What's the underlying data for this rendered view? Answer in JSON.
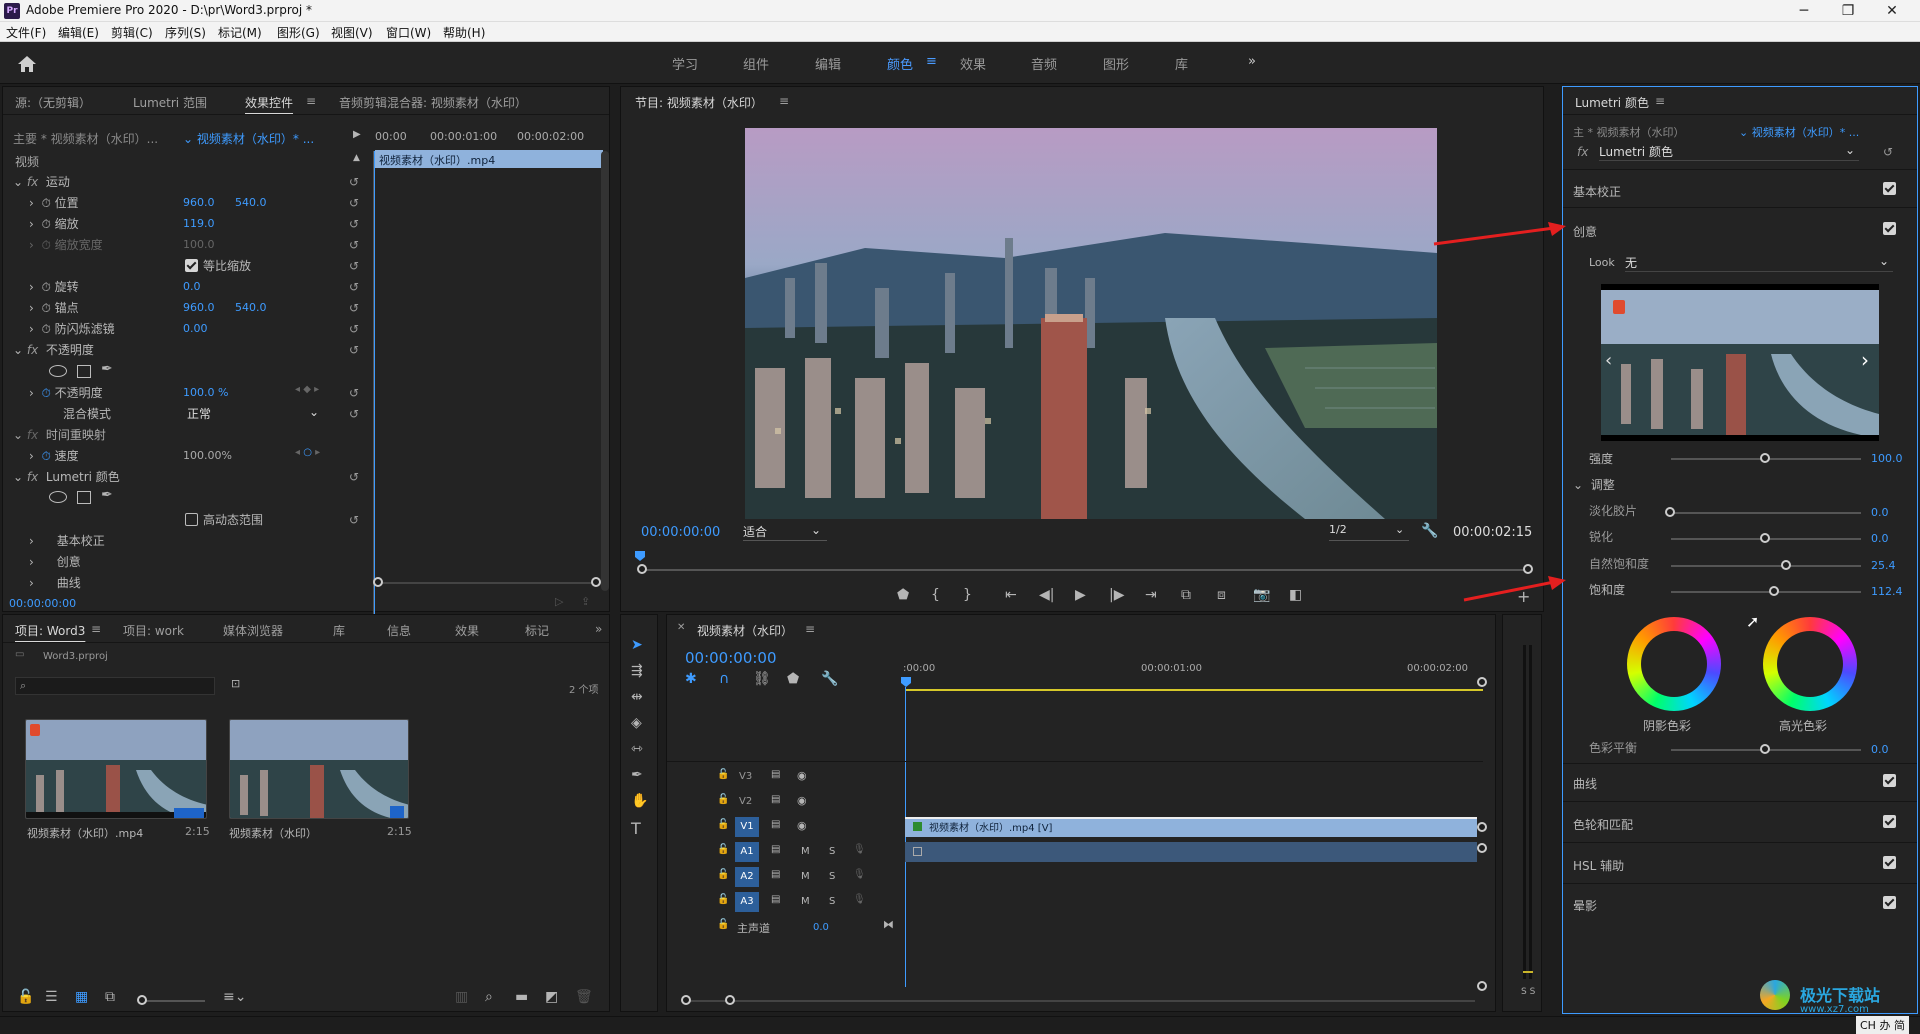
{
  "app": {
    "title": "Adobe Premiere Pro 2020 - D:\\pr\\Word3.prproj *",
    "icon": "Pr"
  },
  "menu": [
    "文件(F)",
    "编辑(E)",
    "剪辑(C)",
    "序列(S)",
    "标记(M)",
    "图形(G)",
    "视图(V)",
    "窗口(W)",
    "帮助(H)"
  ],
  "workspaces": {
    "tabs": [
      "学习",
      "组件",
      "编辑",
      "颜色",
      "效果",
      "音频",
      "图形",
      "库"
    ],
    "active": "颜色",
    "more": "»"
  },
  "effect_controls": {
    "tabs": [
      "源:（无剪辑）",
      "Lumetri 范围",
      "效果控件",
      "音频剪辑混合器: 视频素材（水印）"
    ],
    "active_tab": "效果控件",
    "master": "主要 * 视频素材（水印）...",
    "clip": "视频素材（水印）* ...",
    "ruler": [
      "00:00",
      "00:00:01:00",
      "00:00:02:00"
    ],
    "clip_bar": "视频素材（水印）.mp4",
    "section_video": "视频",
    "motion": "运动",
    "position": {
      "label": "位置",
      "x": "960.0",
      "y": "540.0"
    },
    "scale": {
      "label": "缩放",
      "value": "119.0"
    },
    "scale_width": {
      "label": "缩放宽度",
      "value": "100.0"
    },
    "uniform": "等比缩放",
    "rotation": {
      "label": "旋转",
      "value": "0.0"
    },
    "anchor": {
      "label": "锚点",
      "x": "960.0",
      "y": "540.0"
    },
    "flicker": {
      "label": "防闪烁滤镜",
      "value": "0.00"
    },
    "opacity_group": "不透明度",
    "opacity": {
      "label": "不透明度",
      "value": "100.0 %"
    },
    "blend": {
      "label": "混合模式",
      "value": "正常"
    },
    "time_remap": "时间重映射",
    "speed": {
      "label": "速度",
      "value": "100.00%"
    },
    "lumetri": "Lumetri 颜色",
    "hdr": "高动态范围",
    "basic": "基本校正",
    "creative": "创意",
    "curves": "曲线",
    "timecode": "00:00:00:00"
  },
  "program": {
    "title": "节目: 视频素材（水印）",
    "timecode": "00:00:00:00",
    "fit": "适合",
    "resolution": "1/2",
    "duration": "00:00:02:15"
  },
  "project": {
    "tabs": [
      "项目: Word3",
      "项目: work",
      "媒体浏览器",
      "库",
      "信息",
      "效果",
      "标记"
    ],
    "active_tab": "项目: Word3",
    "file": "Word3.prproj",
    "count": "2 个项",
    "items": [
      {
        "name": "视频素材（水印）.mp4",
        "duration": "2:15"
      },
      {
        "name": "视频素材（水印）",
        "duration": "2:15"
      }
    ]
  },
  "timeline": {
    "title": "视频素材（水印）",
    "timecode": "00:00:00:00",
    "ruler": [
      ":00:00",
      "00:00:01:00",
      "00:00:02:00"
    ],
    "tracks": {
      "v": [
        "V3",
        "V2",
        "V1"
      ],
      "a": [
        "A1",
        "A2",
        "A3"
      ]
    },
    "m": "M",
    "s": "S",
    "master": "主声道",
    "master_val": "0.0",
    "clip": "视频素材（水印）.mp4 [V]",
    "meter_labels": "S S"
  },
  "lumetri": {
    "title": "Lumetri 颜色",
    "master": "主 * 视频素材（水印）",
    "clip": "视频素材（水印）* ...",
    "fx": "Lumetri 颜色",
    "sections": {
      "basic": "基本校正",
      "creative": "创意",
      "curves": "曲线",
      "wheels": "色轮和匹配",
      "hsl": "HSL 辅助",
      "vignette": "晕影"
    },
    "look_label": "Look",
    "look_value": "无",
    "intensity": {
      "label": "强度",
      "value": "100.0"
    },
    "adjust": "调整",
    "faded": {
      "label": "淡化胶片",
      "value": "0.0"
    },
    "sharpen": {
      "label": "锐化",
      "value": "0.0"
    },
    "vibrance": {
      "label": "自然饱和度",
      "value": "25.4"
    },
    "saturation": {
      "label": "饱和度",
      "value": "112.4"
    },
    "shadow": "阴影色彩",
    "highlight": "高光色彩",
    "balance": {
      "label": "色彩平衡",
      "value": "0.0"
    }
  },
  "watermark": {
    "brand": "极光下载站",
    "url": "www.xz7.com"
  },
  "ime": "CH 办 简"
}
